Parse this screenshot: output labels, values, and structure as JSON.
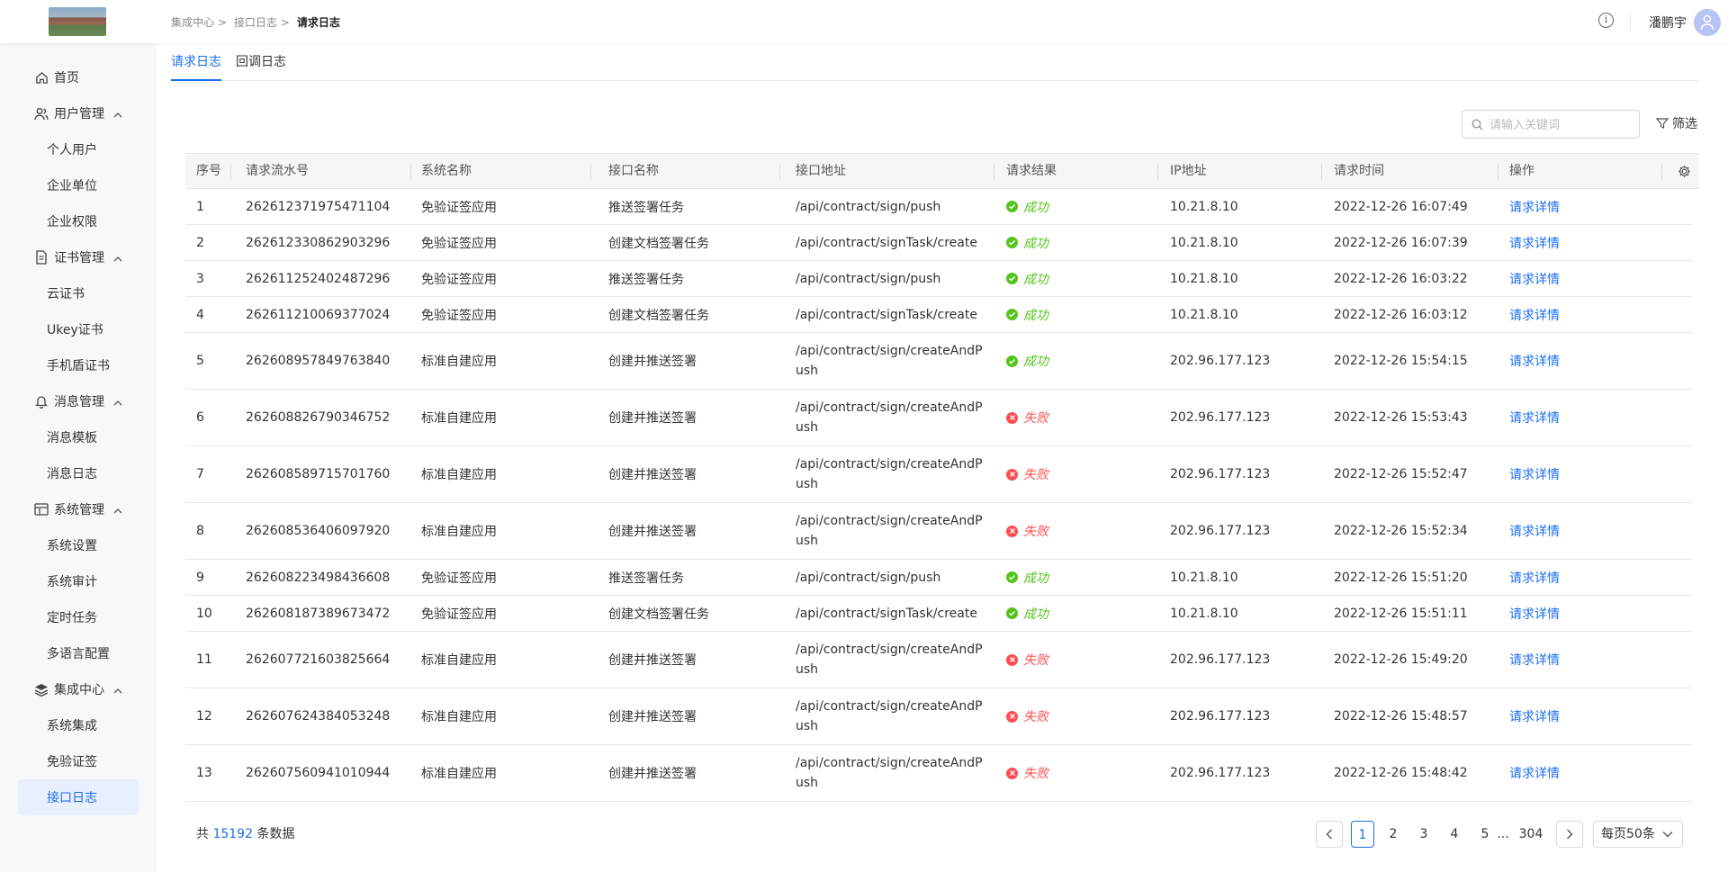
{
  "header": {
    "breadcrumb": [
      "集成中心",
      "接口日志",
      "请求日志"
    ],
    "separator": ">",
    "username": "潘鹏宇"
  },
  "sidebar": {
    "items": [
      {
        "label": "首页",
        "type": "item",
        "icon": "home-icon"
      },
      {
        "label": "用户管理",
        "type": "group",
        "icon": "users-icon"
      },
      {
        "label": "个人用户",
        "type": "sub"
      },
      {
        "label": "企业单位",
        "type": "sub"
      },
      {
        "label": "企业权限",
        "type": "sub"
      },
      {
        "label": "证书管理",
        "type": "group",
        "icon": "certificate-icon"
      },
      {
        "label": "云证书",
        "type": "sub"
      },
      {
        "label": "Ukey证书",
        "type": "sub"
      },
      {
        "label": "手机盾证书",
        "type": "sub"
      },
      {
        "label": "消息管理",
        "type": "group",
        "icon": "bell-icon"
      },
      {
        "label": "消息模板",
        "type": "sub"
      },
      {
        "label": "消息日志",
        "type": "sub"
      },
      {
        "label": "系统管理",
        "type": "group",
        "icon": "system-icon"
      },
      {
        "label": "系统设置",
        "type": "sub"
      },
      {
        "label": "系统审计",
        "type": "sub"
      },
      {
        "label": "定时任务",
        "type": "sub"
      },
      {
        "label": "多语言配置",
        "type": "sub"
      },
      {
        "label": "集成中心",
        "type": "group",
        "icon": "layers-icon"
      },
      {
        "label": "系统集成",
        "type": "sub"
      },
      {
        "label": "免验证签",
        "type": "sub"
      },
      {
        "label": "接口日志",
        "type": "sub",
        "active": true
      }
    ]
  },
  "tabs": [
    {
      "label": "请求日志",
      "active": true
    },
    {
      "label": "回调日志",
      "active": false
    }
  ],
  "search": {
    "placeholder": "请输入关键词"
  },
  "filter_label": "筛选",
  "table": {
    "columns": [
      "序号",
      "请求流水号",
      "系统名称",
      "接口名称",
      "接口地址",
      "请求结果",
      "IP地址",
      "请求时间",
      "操作"
    ],
    "rows": [
      {
        "no": "1",
        "serial": "262612371975471104",
        "system": "免验证签应用",
        "api": "推送签署任务",
        "addr": "/api/contract/sign/push",
        "result": "成功",
        "ok": true,
        "ip": "10.21.8.10",
        "time": "2022-12-26 16:07:49",
        "action": "请求详情"
      },
      {
        "no": "2",
        "serial": "262612330862903296",
        "system": "免验证签应用",
        "api": "创建文档签署任务",
        "addr": "/api/contract/signTask/create",
        "result": "成功",
        "ok": true,
        "ip": "10.21.8.10",
        "time": "2022-12-26 16:07:39",
        "action": "请求详情"
      },
      {
        "no": "3",
        "serial": "262611252402487296",
        "system": "免验证签应用",
        "api": "推送签署任务",
        "addr": "/api/contract/sign/push",
        "result": "成功",
        "ok": true,
        "ip": "10.21.8.10",
        "time": "2022-12-26 16:03:22",
        "action": "请求详情"
      },
      {
        "no": "4",
        "serial": "262611210069377024",
        "system": "免验证签应用",
        "api": "创建文档签署任务",
        "addr": "/api/contract/signTask/create",
        "result": "成功",
        "ok": true,
        "ip": "10.21.8.10",
        "time": "2022-12-26 16:03:12",
        "action": "请求详情"
      },
      {
        "no": "5",
        "serial": "262608957849763840",
        "system": "标准自建应用",
        "api": "创建并推送签署",
        "addr": "/api/contract/sign/createAndPush",
        "result": "成功",
        "ok": true,
        "ip": "202.96.177.123",
        "time": "2022-12-26 15:54:15",
        "action": "请求详情"
      },
      {
        "no": "6",
        "serial": "262608826790346752",
        "system": "标准自建应用",
        "api": "创建并推送签署",
        "addr": "/api/contract/sign/createAndPush",
        "result": "失败",
        "ok": false,
        "ip": "202.96.177.123",
        "time": "2022-12-26 15:53:43",
        "action": "请求详情"
      },
      {
        "no": "7",
        "serial": "262608589715701760",
        "system": "标准自建应用",
        "api": "创建并推送签署",
        "addr": "/api/contract/sign/createAndPush",
        "result": "失败",
        "ok": false,
        "ip": "202.96.177.123",
        "time": "2022-12-26 15:52:47",
        "action": "请求详情"
      },
      {
        "no": "8",
        "serial": "262608536406097920",
        "system": "标准自建应用",
        "api": "创建并推送签署",
        "addr": "/api/contract/sign/createAndPush",
        "result": "失败",
        "ok": false,
        "ip": "202.96.177.123",
        "time": "2022-12-26 15:52:34",
        "action": "请求详情"
      },
      {
        "no": "9",
        "serial": "262608223498436608",
        "system": "免验证签应用",
        "api": "推送签署任务",
        "addr": "/api/contract/sign/push",
        "result": "成功",
        "ok": true,
        "ip": "10.21.8.10",
        "time": "2022-12-26 15:51:20",
        "action": "请求详情"
      },
      {
        "no": "10",
        "serial": "262608187389673472",
        "system": "免验证签应用",
        "api": "创建文档签署任务",
        "addr": "/api/contract/signTask/create",
        "result": "成功",
        "ok": true,
        "ip": "10.21.8.10",
        "time": "2022-12-26 15:51:11",
        "action": "请求详情"
      },
      {
        "no": "11",
        "serial": "262607721603825664",
        "system": "标准自建应用",
        "api": "创建并推送签署",
        "addr": "/api/contract/sign/createAndPush",
        "result": "失败",
        "ok": false,
        "ip": "202.96.177.123",
        "time": "2022-12-26 15:49:20",
        "action": "请求详情"
      },
      {
        "no": "12",
        "serial": "262607624384053248",
        "system": "标准自建应用",
        "api": "创建并推送签署",
        "addr": "/api/contract/sign/createAndPush",
        "result": "失败",
        "ok": false,
        "ip": "202.96.177.123",
        "time": "2022-12-26 15:48:57",
        "action": "请求详情"
      },
      {
        "no": "13",
        "serial": "262607560941010944",
        "system": "标准自建应用",
        "api": "创建并推送签署",
        "addr": "/api/contract/sign/createAndPush",
        "result": "失败",
        "ok": false,
        "ip": "202.96.177.123",
        "time": "2022-12-26 15:48:42",
        "action": "请求详情"
      }
    ]
  },
  "footer": {
    "total_prefix": "共",
    "total_count": "15192",
    "total_suffix": "条数据",
    "pages": [
      "1",
      "2",
      "3",
      "4",
      "5"
    ],
    "ellipsis": "...",
    "last_page": "304",
    "current_page": "1",
    "page_size_label": "每页50条"
  },
  "colors": {
    "accent": "#1a6ef2",
    "success": "#52c41a",
    "fail": "#ff4d4f"
  }
}
